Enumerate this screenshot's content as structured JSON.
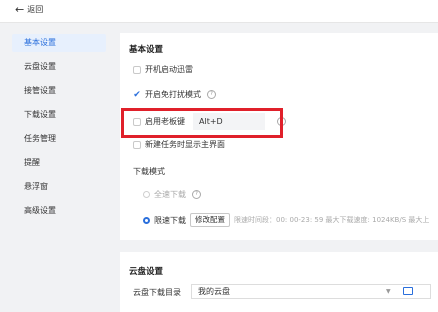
{
  "header": {
    "back_label": "返回"
  },
  "sidebar": {
    "items": [
      {
        "label": "基本设置"
      },
      {
        "label": "云盘设置"
      },
      {
        "label": "接管设置"
      },
      {
        "label": "下载设置"
      },
      {
        "label": "任务管理"
      },
      {
        "label": "提醒"
      },
      {
        "label": "悬浮窗"
      },
      {
        "label": "高级设置"
      }
    ],
    "active_index": 0
  },
  "basic": {
    "title": "基本设置",
    "startup": {
      "label": "开机启动迅雷",
      "checked": false
    },
    "no_disturb": {
      "label": "开启免打扰模式",
      "checked": true
    },
    "boss_key": {
      "label": "启用老板键",
      "checked": false,
      "value": "Alt+D"
    },
    "show_main": {
      "label": "新建任务时显示主界面"
    },
    "download_mode": {
      "title": "下载模式",
      "full_speed": {
        "label": "全速下载",
        "selected": false
      },
      "limited": {
        "label": "限速下载",
        "selected": true,
        "edit_button": "修改配置",
        "info": "限速时间段：00: 00-23: 59  最大下载速度: 1024KB/S  最大上"
      }
    }
  },
  "cloud": {
    "title": "云盘设置",
    "dir_label": "云盘下载目录",
    "dir_value": "我的云盘"
  },
  "colors": {
    "accent": "#2a6fdc",
    "highlight": "#e0202a"
  }
}
